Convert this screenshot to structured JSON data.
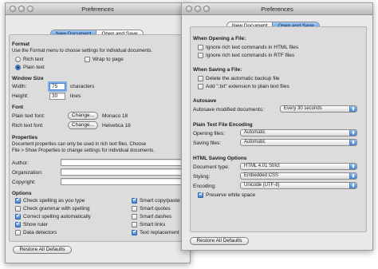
{
  "back_window": {
    "title": "Preferences",
    "tabs": [
      "New Document",
      "Open and Save"
    ],
    "format": {
      "heading": "Format",
      "description": "Use the Format menu to choose settings for individual documents.",
      "rich_text": "Rich text",
      "plain_text": "Plain text",
      "selected": "Plain text",
      "wrap_to_page": "Wrap to page",
      "wrap_checked": false
    },
    "window_size": {
      "heading": "Window Size",
      "width_label": "Width:",
      "width_value": "75",
      "width_unit": "characters",
      "height_label": "Height:",
      "height_value": "30",
      "height_unit": "lines"
    },
    "font": {
      "heading": "Font",
      "plain_label": "Plain text font:",
      "plain_button": "Change...",
      "plain_font": "Monaco 18",
      "rich_label": "Rich text font:",
      "rich_button": "Change...",
      "rich_font": "Helvetica 18"
    },
    "properties": {
      "heading": "Properties",
      "description_1": "Document properties can only be used in rich text files. Choose",
      "description_2": "File > Show Properties to change settings for individual documents.",
      "author_label": "Author:",
      "author_value": "",
      "organization_label": "Organization:",
      "organization_value": "",
      "copyright_label": "Copyright:",
      "copyright_value": ""
    },
    "options": {
      "heading": "Options",
      "left": [
        {
          "label": "Check spelling as you type",
          "checked": true
        },
        {
          "label": "Check grammar with spelling",
          "checked": false
        },
        {
          "label": "Correct spelling automatically",
          "checked": true
        },
        {
          "label": "Show ruler",
          "checked": true
        },
        {
          "label": "Data detectors",
          "checked": false
        }
      ],
      "right": [
        {
          "label": "Smart copy/paste",
          "checked": true
        },
        {
          "label": "Smart quotes",
          "checked": false
        },
        {
          "label": "Smart dashes",
          "checked": false
        },
        {
          "label": "Smart links",
          "checked": false
        },
        {
          "label": "Text replacement",
          "checked": true
        }
      ]
    },
    "restore_button": "Restore All Defaults"
  },
  "front_window": {
    "title": "Preferences",
    "tabs": [
      "New Document",
      "Open and Save"
    ],
    "opening": {
      "heading": "When Opening a File:",
      "items": [
        {
          "label": "Ignore rich text commands in HTML files",
          "checked": false
        },
        {
          "label": "Ignore rich text commands in RTF files",
          "checked": false
        }
      ]
    },
    "saving": {
      "heading": "When Saving a File:",
      "items": [
        {
          "label": "Delete the automatic backup file",
          "checked": false
        },
        {
          "label": "Add \".txt\" extension to plain text files",
          "checked": false
        }
      ]
    },
    "autosave": {
      "heading": "Autosave",
      "label": "Autosave modified documents:",
      "value": "Every 30 seconds"
    },
    "encoding": {
      "heading": "Plain Text File Encoding",
      "opening_label": "Opening files:",
      "opening_value": "Automatic",
      "saving_label": "Saving files:",
      "saving_value": "Automatic"
    },
    "html": {
      "heading": "HTML Saving Options",
      "doctype_label": "Document type:",
      "doctype_value": "HTML 4.01 Strict",
      "styling_label": "Styling:",
      "styling_value": "Embedded CSS",
      "encoding_label": "Encoding:",
      "encoding_value": "Unicode (UTF-8)",
      "preserve_label": "Preserve white space",
      "preserve_checked": true
    },
    "restore_button": "Restore All Defaults"
  },
  "colors": {
    "accent": "#3f7fd6",
    "window_bg": "#e9e9e9",
    "panel_bg": "#dcdcdc"
  }
}
